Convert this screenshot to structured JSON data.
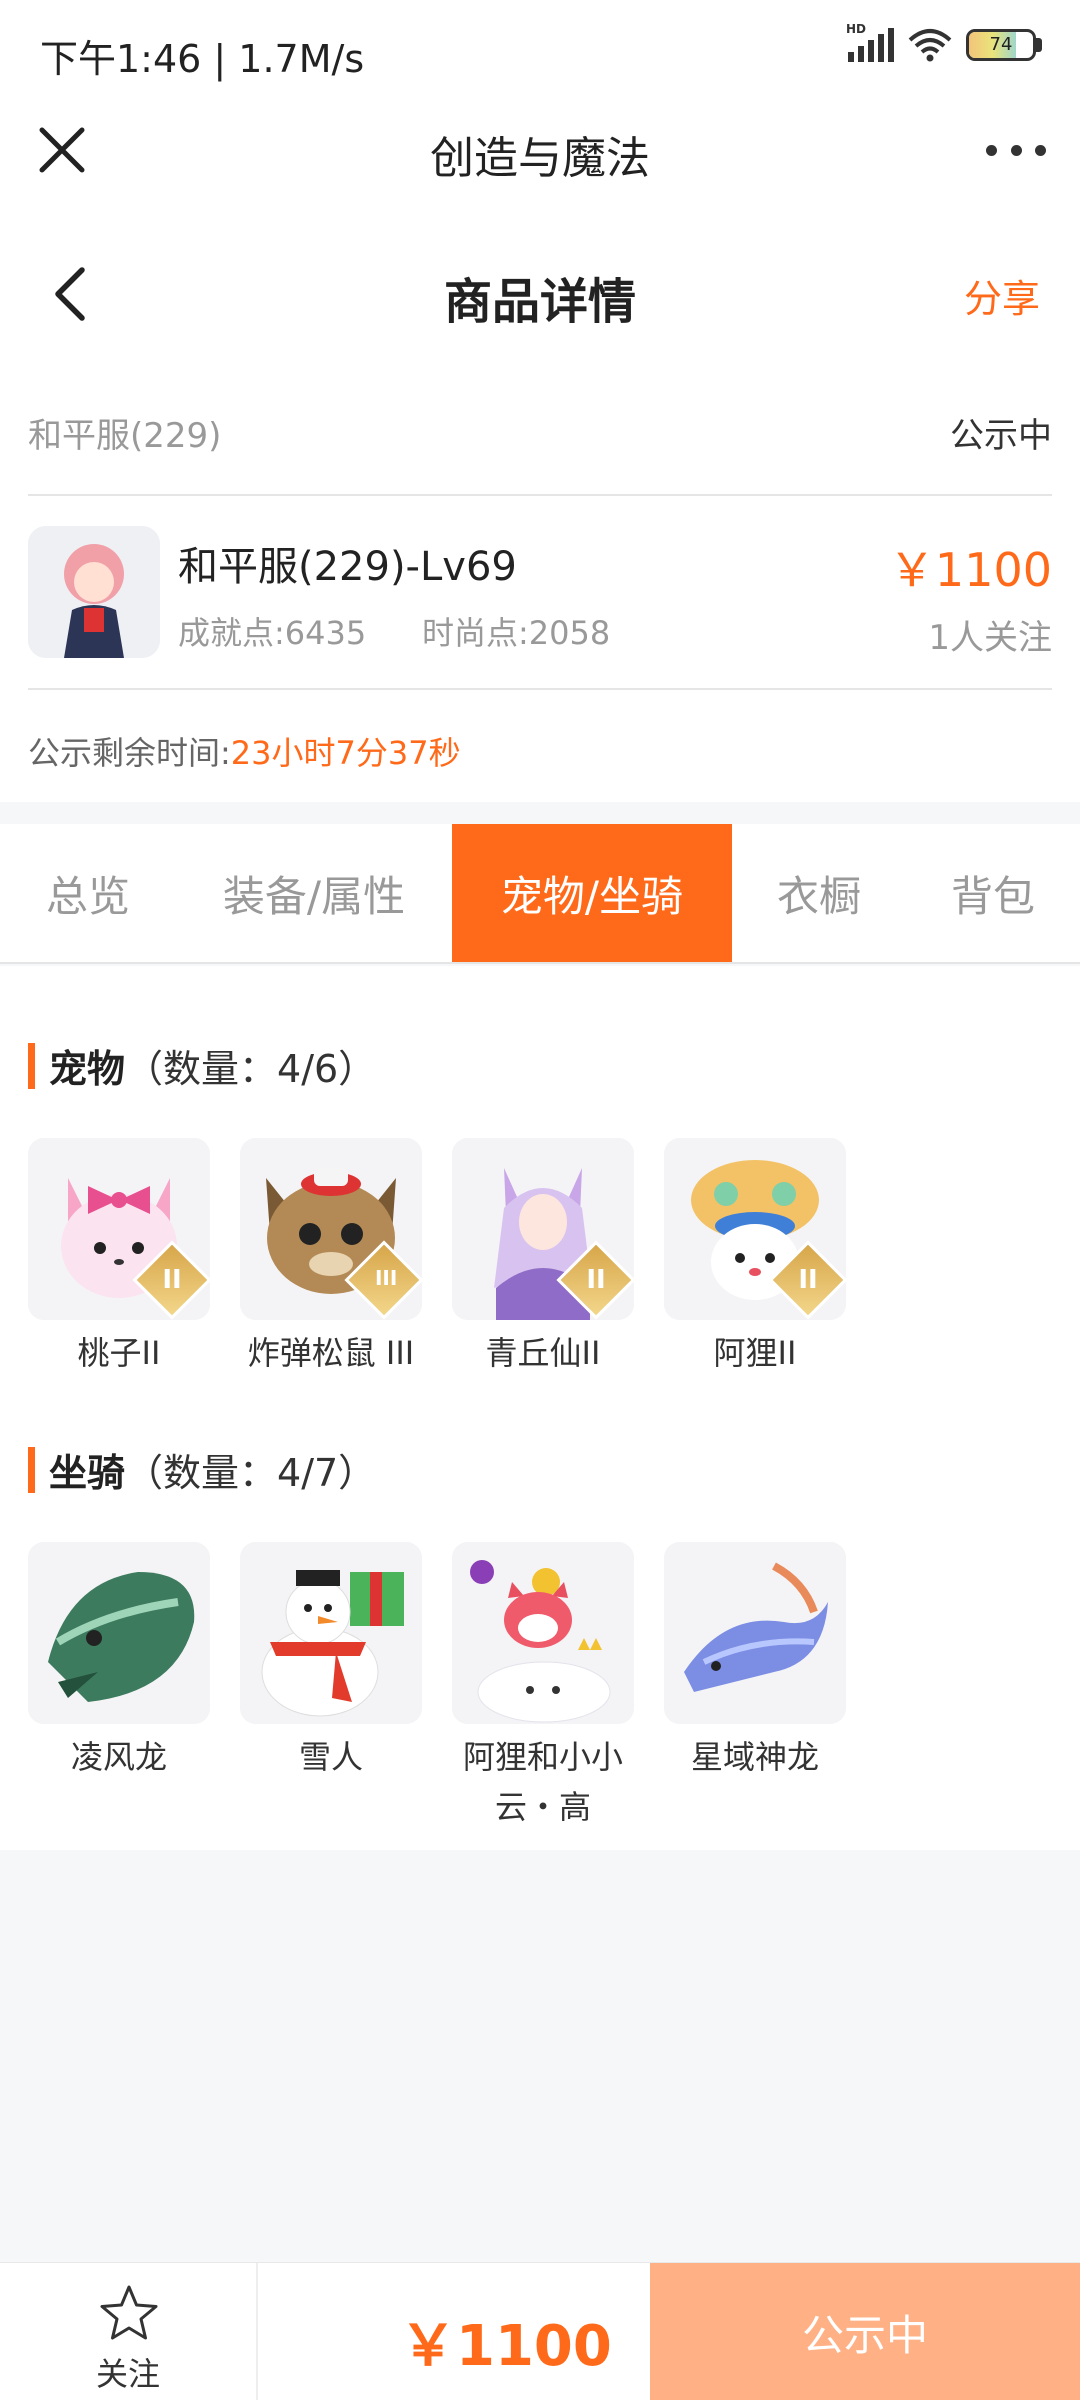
{
  "status_bar": {
    "time": "下午1:46 | 1.7M/s",
    "battery": "74"
  },
  "app_header": {
    "title": "创造与魔法"
  },
  "page_header": {
    "title": "商品详情",
    "share_label": "分享"
  },
  "info": {
    "server": "和平服(229)",
    "state": "公示中",
    "product_name": "和平服(229)-Lv69",
    "achievement": "成就点:6435",
    "fashion": "时尚点:2058",
    "price": "￥1100",
    "followers": "1人关注",
    "remaining_label": "公示剩余时间:",
    "remaining_value": "23小时7分37秒"
  },
  "tabs": [
    {
      "label": "总览"
    },
    {
      "label": "装备/属性"
    },
    {
      "label": "宠物/坐骑"
    },
    {
      "label": "衣橱"
    },
    {
      "label": "背包"
    }
  ],
  "active_tab": "宠物/坐骑",
  "pets": {
    "title": "宠物",
    "count": "（数量：4/6）",
    "items": [
      {
        "name": "桃子II",
        "tier": "II"
      },
      {
        "name": "炸弹松鼠 III",
        "tier": "III"
      },
      {
        "name": "青丘仙II",
        "tier": "II"
      },
      {
        "name": "阿狸II",
        "tier": "II"
      }
    ]
  },
  "mounts": {
    "title": "坐骑",
    "count": "（数量：4/7）",
    "items": [
      {
        "name": "凌风龙"
      },
      {
        "name": "雪人"
      },
      {
        "name": "阿狸和小小云・高"
      },
      {
        "name": "星域神龙"
      }
    ]
  },
  "bottom_bar": {
    "follow_label": "关注",
    "price": "￥1100",
    "action_label": "公示中"
  },
  "colors": {
    "accent": "#ff6a1a",
    "action_button": "#ffb085"
  }
}
